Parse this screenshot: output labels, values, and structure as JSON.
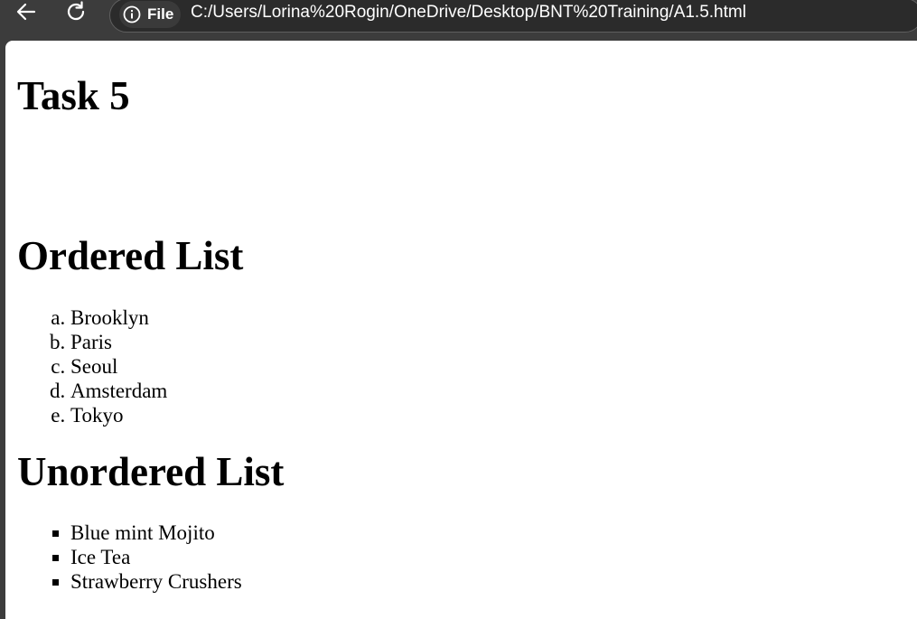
{
  "browser": {
    "site_label": "File",
    "url": "C:/Users/Lorina%20Rogin/OneDrive/Desktop/BNT%20Training/A1.5.html",
    "icons": [
      "back-arrow-icon",
      "reload-icon",
      "info-icon"
    ]
  },
  "page": {
    "title": "Task 5",
    "ordered_heading": "Ordered List",
    "ordered_items": [
      "Brooklyn",
      "Paris",
      "Seoul",
      "Amsterdam",
      "Tokyo"
    ],
    "unordered_heading": "Unordered List",
    "unordered_items": [
      "Blue mint Mojito",
      "Ice Tea",
      "Strawberry Crushers"
    ]
  }
}
